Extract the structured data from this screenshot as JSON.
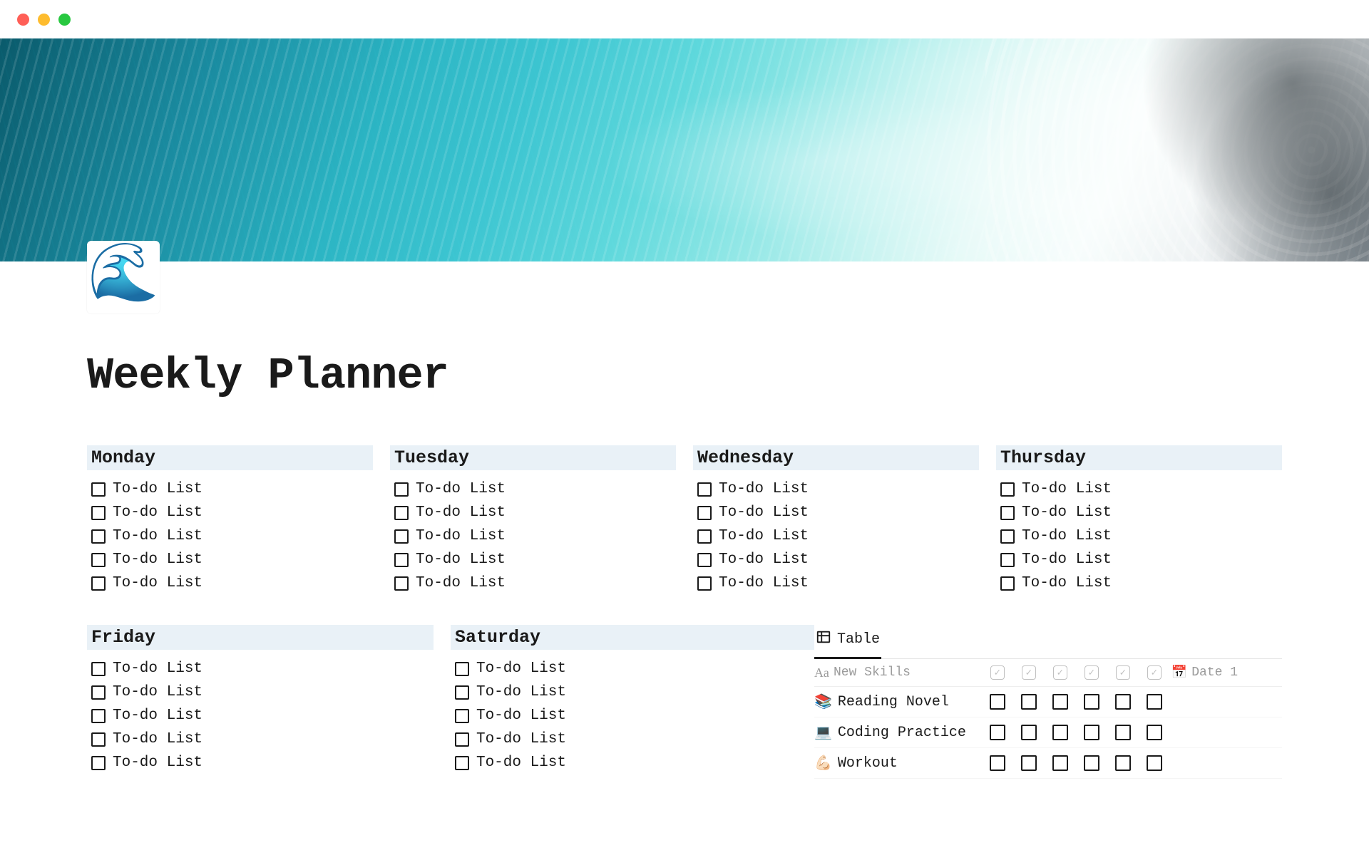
{
  "page": {
    "icon": "🌊",
    "title": "Weekly Planner"
  },
  "days_top": [
    {
      "name": "Monday",
      "items": [
        "To-do List",
        "To-do List",
        "To-do List",
        "To-do List",
        "To-do List"
      ]
    },
    {
      "name": "Tuesday",
      "items": [
        "To-do List",
        "To-do List",
        "To-do List",
        "To-do List",
        "To-do List"
      ]
    },
    {
      "name": "Wednesday",
      "items": [
        "To-do List",
        "To-do List",
        "To-do List",
        "To-do List",
        "To-do List"
      ]
    },
    {
      "name": "Thursday",
      "items": [
        "To-do List",
        "To-do List",
        "To-do List",
        "To-do List",
        "To-do List"
      ]
    }
  ],
  "days_bottom": [
    {
      "name": "Friday",
      "items": [
        "To-do List",
        "To-do List",
        "To-do List",
        "To-do List",
        "To-do List"
      ]
    },
    {
      "name": "Saturday",
      "items": [
        "To-do List",
        "To-do List",
        "To-do List",
        "To-do List",
        "To-do List"
      ]
    }
  ],
  "table": {
    "tab_label": "Table",
    "columns": {
      "name": "New Skills",
      "date": "Date 1"
    },
    "check_count": 6,
    "rows": [
      {
        "icon": "📚",
        "name": "Reading Novel",
        "checks": [
          false,
          false,
          false,
          false,
          false,
          false
        ]
      },
      {
        "icon": "💻",
        "name": "Coding Practice",
        "checks": [
          false,
          false,
          false,
          false,
          false,
          false
        ]
      },
      {
        "icon": "💪🏻",
        "name": "Workout",
        "checks": [
          false,
          false,
          false,
          false,
          false,
          false
        ]
      }
    ]
  }
}
